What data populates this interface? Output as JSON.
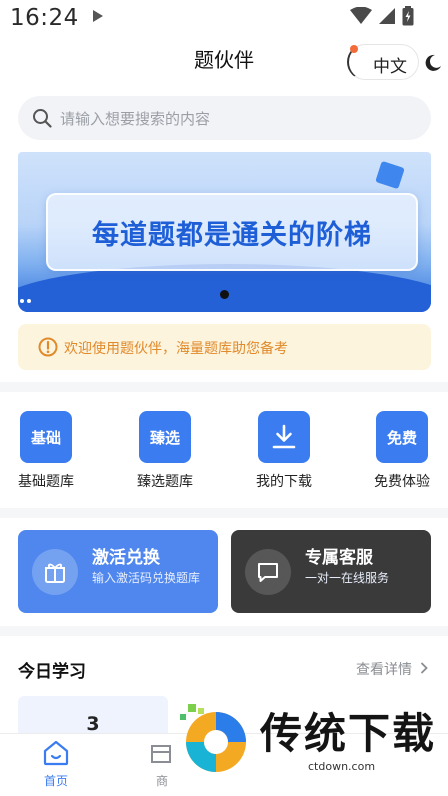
{
  "status_bar": {
    "time": "16:24"
  },
  "header": {
    "title": "题伙伴",
    "language_label": "中文"
  },
  "search": {
    "placeholder": "请输入想要搜索的内容"
  },
  "banner": {
    "headline": "每道题都是通关的阶梯"
  },
  "notice": {
    "text": "欢迎使用题伙伴，海量题库助您备考"
  },
  "quick_actions": [
    {
      "tile_text": "基础",
      "label": "基础题库"
    },
    {
      "tile_text": "臻选",
      "label": "臻选题库"
    },
    {
      "tile_text": "",
      "label": "我的下载",
      "icon": "download-icon"
    },
    {
      "tile_text": "免费",
      "label": "免费体验"
    }
  ],
  "feature_cards": [
    {
      "title": "激活兑换",
      "subtitle": "输入激活码兑换题库",
      "icon": "gift-icon",
      "color": "#4f87ee"
    },
    {
      "title": "专属客服",
      "subtitle": "一对一在线服务",
      "icon": "chat-icon",
      "color": "#3a3a3a"
    }
  ],
  "today_study": {
    "title": "今日学习",
    "link": "查看详情",
    "stat_value": "3"
  },
  "tab_bar": {
    "tabs": [
      {
        "label": "首页",
        "icon": "home-icon",
        "active": true
      },
      {
        "label": "商",
        "icon": "shop-icon",
        "active": false
      }
    ]
  },
  "watermark": {
    "brand": "传统下载",
    "url": "ctdown.com"
  },
  "colors": {
    "primary": "#3b7cf0",
    "notice_text": "#e08a2b",
    "notice_bg": "#fdf4de"
  }
}
